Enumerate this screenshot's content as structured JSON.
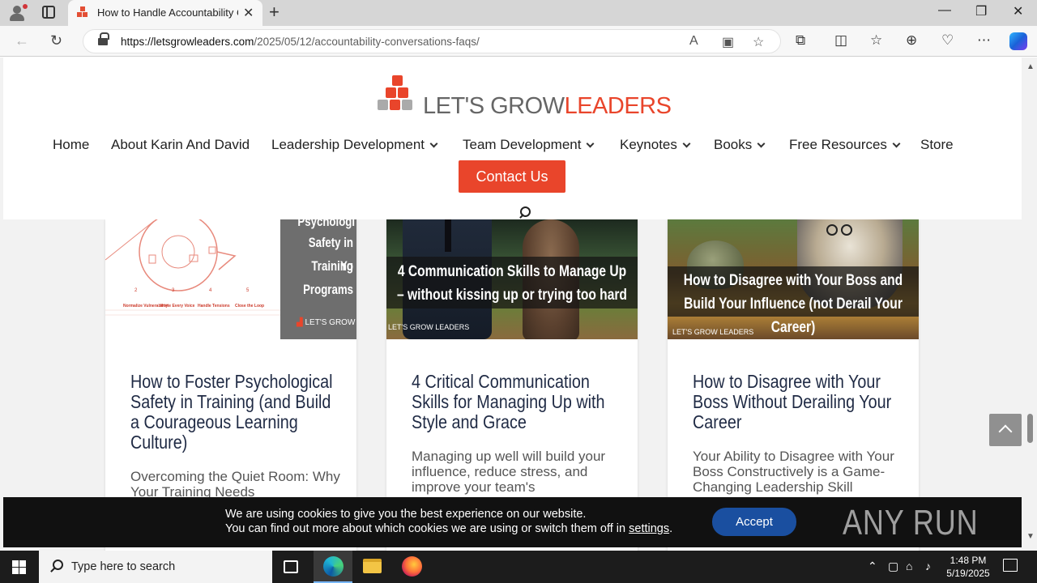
{
  "browser": {
    "tab_title": "How to Handle Accountability Co",
    "url_host": "https://letsgrowleaders.com",
    "url_path": "/2025/05/12/accountability-conversations-faqs/",
    "window": {
      "minimize": "—",
      "maximize": "❐",
      "close": "✕"
    }
  },
  "site": {
    "logo": {
      "word1": "LET'S GROW",
      "word2": "LEADERS"
    },
    "nav": [
      {
        "label": "Home",
        "dropdown": false
      },
      {
        "label": "About Karin And David",
        "dropdown": false
      },
      {
        "label": "Leadership Development",
        "dropdown": true
      },
      {
        "label": "Team Development",
        "dropdown": true
      },
      {
        "label": "Keynotes",
        "dropdown": true
      },
      {
        "label": "Books",
        "dropdown": true
      },
      {
        "label": "Free Resources",
        "dropdown": true
      },
      {
        "label": "Store",
        "dropdown": false
      }
    ],
    "contact_label": "Contact Us",
    "brand_color": "#e9452b"
  },
  "cards": [
    {
      "image_text": [
        "Psychologi",
        "Safety in Yo",
        "Training",
        "Programs"
      ],
      "image_brand": "LET'S GROW LE",
      "image_labels": [
        "Normalize Vulnerability",
        "Invite Every Voice",
        "Handle Tensions",
        "Close the Loop"
      ],
      "title": "How to Foster Psychological Safety in Training (and Build a Courageous Learning Culture)",
      "excerpt": "Overcoming the Quiet Room: Why Your Training Needs"
    },
    {
      "image_text": "4 Communication Skills to Manage Up – without kissing up or trying too hard",
      "image_brand": "LET'S GROW LEADERS",
      "title": "4 Critical Communication Skills for Managing Up with Style and Grace",
      "excerpt": "Managing up well will build your influence, reduce stress, and improve your team's"
    },
    {
      "image_text": "How to Disagree with Your Boss and Build Your Influence (not Derail Your Career)",
      "image_brand": "LET'S GROW LEADERS",
      "title": "How to Disagree with Your Boss Without Derailing Your Career",
      "excerpt": "Your Ability to Disagree with Your Boss Constructively is a Game-Changing Leadership Skill"
    }
  ],
  "cookie": {
    "line1": "We are using cookies to give you the best experience on our website.",
    "line2_prefix": "You can find out more about which cookies we are using or switch them off in ",
    "line2_link": "settings",
    "line2_suffix": ".",
    "accept_label": "Accept"
  },
  "watermark": "ANY RUN",
  "taskbar": {
    "search_placeholder": "Type here to search",
    "time": "1:48 PM",
    "date": "5/19/2025"
  }
}
